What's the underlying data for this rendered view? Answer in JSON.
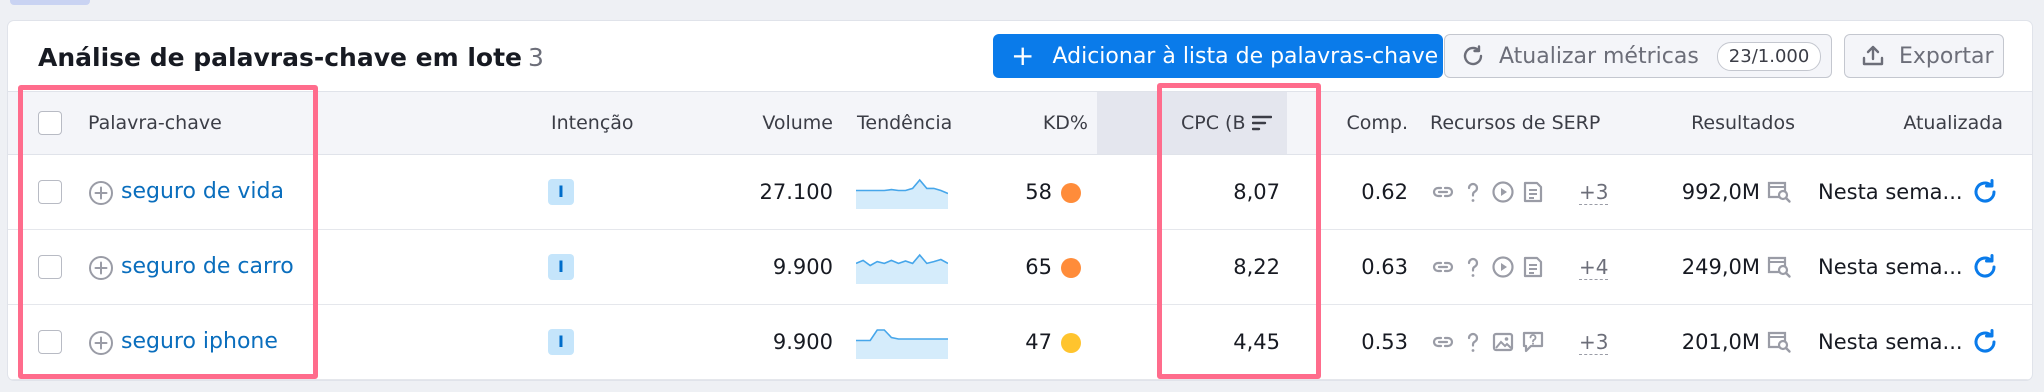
{
  "panel": {
    "title": "Análise de palavras-chave em lote",
    "count": "3"
  },
  "toolbar": {
    "add_label": "Adicionar à lista de palavras-chave",
    "refresh_label": "Atualizar métricas",
    "refresh_quota": "23/1.000",
    "export_label": "Exportar"
  },
  "columns": {
    "keyword": "Palavra-chave",
    "intent": "Intenção",
    "volume": "Volume",
    "trend": "Tendência",
    "kd": "KD%",
    "cpc": "CPC (B",
    "comp": "Comp.",
    "serp": "Recursos de SERP",
    "results": "Resultados",
    "updated": "Atualizada"
  },
  "rows": [
    {
      "keyword": "seguro de vida",
      "intent": "I",
      "volume": "27.100",
      "kd": "58",
      "kd_color": "#ff8c3a",
      "cpc": "8,07",
      "comp": "0.62",
      "serp_icons": [
        "link-icon",
        "question-icon",
        "video-icon",
        "article-icon"
      ],
      "serp_more": "+3",
      "results": "992,0M",
      "updated": "Nesta sema...",
      "trend": [
        0.55,
        0.55,
        0.55,
        0.55,
        0.55,
        0.58,
        0.55,
        0.55,
        0.62,
        0.9,
        0.62,
        0.62,
        0.55,
        0.45
      ]
    },
    {
      "keyword": "seguro de carro",
      "intent": "I",
      "volume": "9.900",
      "kd": "65",
      "kd_color": "#ff8c3a",
      "cpc": "8,22",
      "comp": "0.63",
      "serp_icons": [
        "link-icon",
        "question-icon",
        "video-icon",
        "article-icon"
      ],
      "serp_more": "+4",
      "results": "249,0M",
      "updated": "Nesta sema...",
      "trend": [
        0.62,
        0.72,
        0.55,
        0.68,
        0.62,
        0.72,
        0.62,
        0.7,
        0.62,
        0.9,
        0.62,
        0.68,
        0.75,
        0.62
      ]
    },
    {
      "keyword": "seguro iphone",
      "intent": "I",
      "volume": "9.900",
      "kd": "47",
      "kd_color": "#ffc42e",
      "cpc": "4,45",
      "comp": "0.53",
      "serp_icons": [
        "link-icon",
        "question-icon",
        "image-icon",
        "faq-icon"
      ],
      "serp_more": "+3",
      "results": "201,0M",
      "updated": "Nesta sema...",
      "trend": [
        0.55,
        0.55,
        0.55,
        0.9,
        0.9,
        0.65,
        0.6,
        0.6,
        0.6,
        0.6,
        0.6,
        0.6,
        0.6,
        0.6
      ]
    }
  ],
  "colors": {
    "accent": "#0a7bea",
    "link": "#0a6ebd",
    "highlight": "#ff6c8c",
    "trend_line": "#46a6ea",
    "trend_fill": "#d5ecfb"
  }
}
